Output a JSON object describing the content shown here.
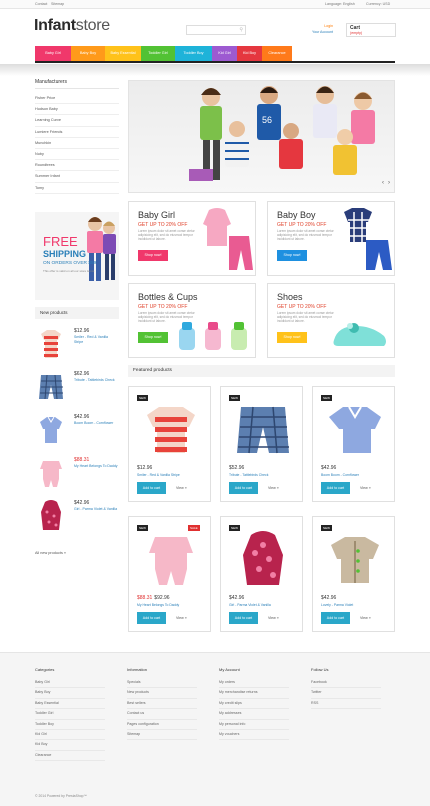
{
  "topbar": {
    "contact": "Contact",
    "sitemap": "Sitemap",
    "language": "Language: English",
    "currency": "Currency: USD"
  },
  "logo": {
    "part1": "Infant",
    "part2": "store"
  },
  "search": {
    "placeholder": ""
  },
  "login": {
    "login": "Login",
    "account": "Your Account"
  },
  "cart": {
    "title": "Cart",
    "status": "(empty)"
  },
  "nav": [
    {
      "label": "Baby Girl",
      "color": "#f0386b"
    },
    {
      "label": "Baby Boy",
      "color": "#ff9a1a"
    },
    {
      "label": "Baby Essential",
      "color": "#ffc21a"
    },
    {
      "label": "Toddler Girl",
      "color": "#52c234"
    },
    {
      "label": "Toddler Boy",
      "color": "#1eb3d9"
    },
    {
      "label": "Kid Girl",
      "color": "#9d5ad1"
    },
    {
      "label": "Kid Boy",
      "color": "#e5373f"
    },
    {
      "label": "Clearance",
      "color": "#ff7a1a"
    }
  ],
  "sidebar": {
    "title": "Manufacturers",
    "items": [
      "Fisher Price",
      "Hudson Baby",
      "Learning Curve",
      "Lumiere Friends",
      "Munchkin",
      "Nuby",
      "Roundtrees",
      "Summer Infant",
      "Tomy"
    ]
  },
  "free": {
    "l1": "FREE",
    "l2": "SHIPPING",
    "l3": "ON ORDERS OVER $59",
    "l4": "This offer is valid on all our store items."
  },
  "new_products": {
    "title": "New products",
    "items": [
      {
        "price": "$12.96",
        "name": "Smiler - Red & Vanilla Stripe"
      },
      {
        "price": "$62.96",
        "name": "Tribute - Tattlebirds Check"
      },
      {
        "price": "$42.96",
        "name": "Boom Boom - Cornflower"
      },
      {
        "price": "$88.31",
        "name": "My Heart Belongs To Daddy"
      },
      {
        "price": "$42.96",
        "name": "Girl - Parma Violet & Vanilla"
      }
    ],
    "all": "All new products »"
  },
  "slider": {
    "prev": "‹",
    "next": "›"
  },
  "promos": [
    {
      "title": "Baby Girl",
      "sub": "GET UP TO 20% OFF",
      "desc": "Lorem ipsum dolor sit amet conse ctetur adipisicing elit, sed do eiusmod tempor incididunt ut labore.",
      "button": "Shop now!",
      "color": "#f0386b"
    },
    {
      "title": "Baby Boy",
      "sub": "GET UP TO 20% OFF",
      "desc": "Lorem ipsum dolor sit amet conse ctetur adipisicing elit, sed do eiusmod tempor incididunt ut labore.",
      "button": "Shop now!",
      "color": "#1e90e0"
    },
    {
      "title": "Bottles & Cups",
      "sub": "GET UP TO 20% OFF",
      "desc": "Lorem ipsum dolor sit amet conse ctetur adipisicing elit, sed do eiusmod tempor incididunt ut labore.",
      "button": "Shop now!",
      "color": "#52c234"
    },
    {
      "title": "Shoes",
      "sub": "GET UP TO 20% OFF",
      "desc": "Lorem ipsum dolor sit amet conse ctetur adipisicing elit, sed do eiusmod tempor incididunt ut labore.",
      "button": "Shop now!",
      "color": "#ffc21a"
    }
  ],
  "featured": {
    "title": "Featured products",
    "cards": [
      {
        "badge": "NEW",
        "price": "$12.96",
        "old": "",
        "name": "Smiler - Red & Vanilla Stripe",
        "add": "Add to cart",
        "view": "View »"
      },
      {
        "badge": "NEW",
        "price": "$52.96",
        "old": "",
        "name": "Tribute - Tattlebirds Check",
        "add": "Add to cart",
        "view": "View »"
      },
      {
        "badge": "NEW",
        "price": "$42.96",
        "old": "",
        "name": "Boom Boom - Cornflower",
        "add": "Add to cart",
        "view": "View »"
      },
      {
        "badge": "NEW",
        "sale": "SALE",
        "price": "$92.96",
        "old": "$88.31",
        "name": "My Heart Belongs To Daddy",
        "add": "Add to cart",
        "view": "View »"
      },
      {
        "badge": "NEW",
        "price": "$42.96",
        "old": "",
        "name": "Girl - Parma Violet & Vanilla",
        "add": "Add to cart",
        "view": "View »"
      },
      {
        "badge": "NEW",
        "price": "$42.96",
        "old": "",
        "name": "Lovely - Parma Violet",
        "add": "Add to cart",
        "view": "View »"
      }
    ]
  },
  "footer": {
    "cols": [
      {
        "title": "Categories",
        "items": [
          "Baby Girl",
          "Baby Boy",
          "Baby Essential",
          "Toddler Girl",
          "Toddler Boy",
          "Kid Girl",
          "Kid Boy",
          "Clearance"
        ]
      },
      {
        "title": "Information",
        "items": [
          "Specials",
          "New products",
          "Best sellers",
          "Contact us",
          "Pages configuration",
          "Sitemap"
        ]
      },
      {
        "title": "My Account",
        "items": [
          "My orders",
          "My merchandise returns",
          "My credit slips",
          "My addresses",
          "My personal info",
          "My vouchers"
        ]
      },
      {
        "title": "Follow Us",
        "items": [
          "Facebook",
          "Twitter",
          "RSS"
        ]
      }
    ],
    "copyright": "© 2014 Powered by PrestaShop™"
  }
}
